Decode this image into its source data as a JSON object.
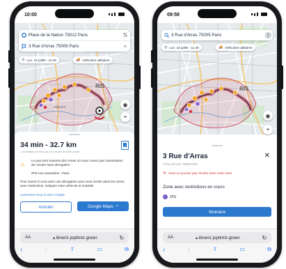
{
  "colors": {
    "route": "#c9354c",
    "accent": "#2b78cf",
    "warning": "#f0b429",
    "error": "#d93030",
    "zfe": "#7b5fc7"
  },
  "left": {
    "time": "10:00",
    "origin": "Place de la Nation 75012 Paris",
    "destination": "3 Rue d'Arras 75005 Paris",
    "date_chip": "Lun. 22 juillet - 11:49",
    "vehicle_chip": "Véhicules utilitaires",
    "map_label": "RIS",
    "map_label2": "ellamont",
    "duration": "34 min - 32.7 km",
    "note": "L'estimation ne tient pas en compte du trafic actuel",
    "warning_text": "Le parcours traverse des zones où vous n'avez pas l'autorisation de circuler sans dérogation :",
    "zfe_line": "ZFE non autorisées : Paris",
    "info_text": "Pour savoir si vous avez une dérogation pour vous rendre dans les zones avec restrictions, indiquez votre véhicule et activités",
    "link_text": "connectez-vous à votre compte",
    "cancel": "Annuler",
    "maps": "Google Maps",
    "url": "itineriz.joptimiz.green",
    "aa": "AA"
  },
  "right": {
    "time": "09:58",
    "search": "3 Rue d'Arras 75005 Paris",
    "date_chip": "Lun. 22 juillet - 11:49",
    "vehicle_chip": "Véhicules utilitaires",
    "map_label": "RIS",
    "title": "3 Rue d'Arras",
    "subtitle": "3 Rue d'Arras 75005 Paris",
    "error": "Vous ne pouvez pas circuler dans cette zone",
    "zone_heading": "Zone avec restrictions en cours",
    "zfe": "ZFE",
    "itinerary": "Itinéraire",
    "url": "itineriz.joptimiz.green",
    "aa": "AA"
  }
}
